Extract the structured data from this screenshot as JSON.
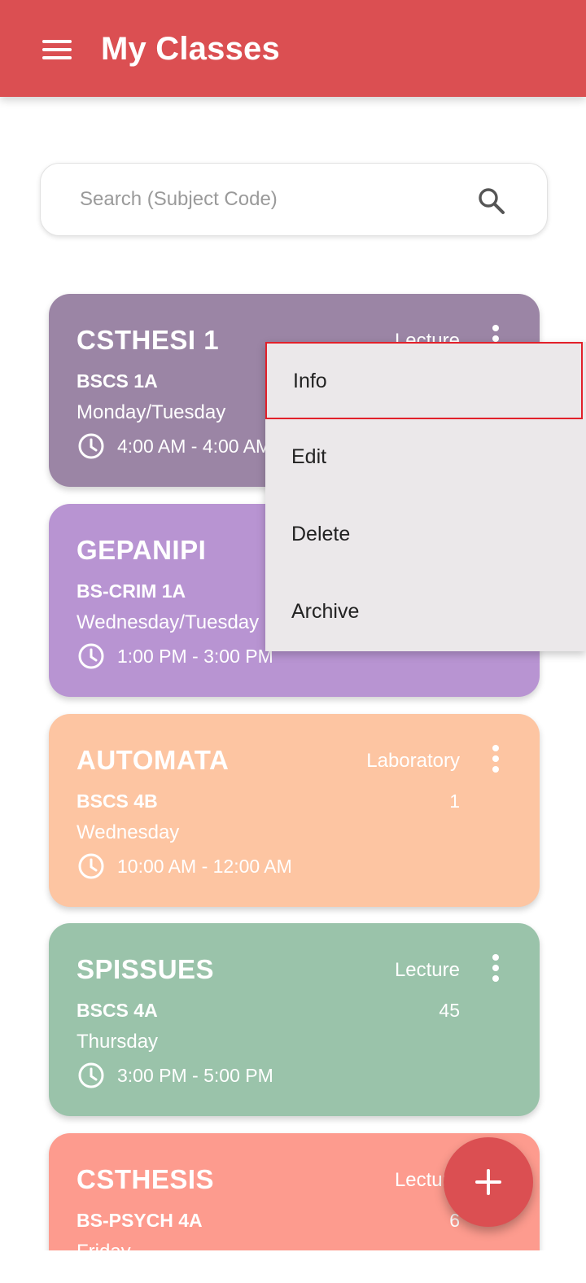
{
  "colors": {
    "appbar": "#db4f52",
    "fab": "#db4f52",
    "menu_highlight_border": "#e2202a"
  },
  "appbar": {
    "title": "My Classes",
    "menu_icon": "hamburger-menu-icon"
  },
  "search": {
    "placeholder": "Search (Subject Code)",
    "value": "",
    "icon": "search-icon"
  },
  "classes": [
    {
      "code": "CSTHESI 1",
      "type": "Lecture",
      "section": "BSCS 1A",
      "count": "",
      "days": "Monday/Tuesday",
      "time": "4:00 AM - 4:00 AM",
      "color": "#9b85a5"
    },
    {
      "code": "GEPANIPI",
      "type": "",
      "section": "BS-CRIM 1A",
      "count": "",
      "days": "Wednesday/Tuesday",
      "time": "1:00 PM - 3:00 PM",
      "color": "#b894d2"
    },
    {
      "code": "AUTOMATA",
      "type": "Laboratory",
      "section": "BSCS 4B",
      "count": "1",
      "days": "Wednesday",
      "time": "10:00 AM - 12:00 AM",
      "color": "#fdc5a2"
    },
    {
      "code": "SPISSUES",
      "type": "Lecture",
      "section": "BSCS 4A",
      "count": "45",
      "days": "Thursday",
      "time": "3:00 PM - 5:00 PM",
      "color": "#9ac3aa"
    },
    {
      "code": "CSTHESIS",
      "type": "Lecture",
      "section": "BS-PSYCH 4A",
      "count": "6",
      "days": "Friday",
      "time": "",
      "color": "#fd9b8e"
    }
  ],
  "context_menu": {
    "items": [
      {
        "label": "Info",
        "highlighted": true
      },
      {
        "label": "Edit"
      },
      {
        "label": "Delete"
      },
      {
        "label": "Archive"
      }
    ]
  },
  "fab": {
    "label": "+",
    "icon": "add-icon"
  }
}
